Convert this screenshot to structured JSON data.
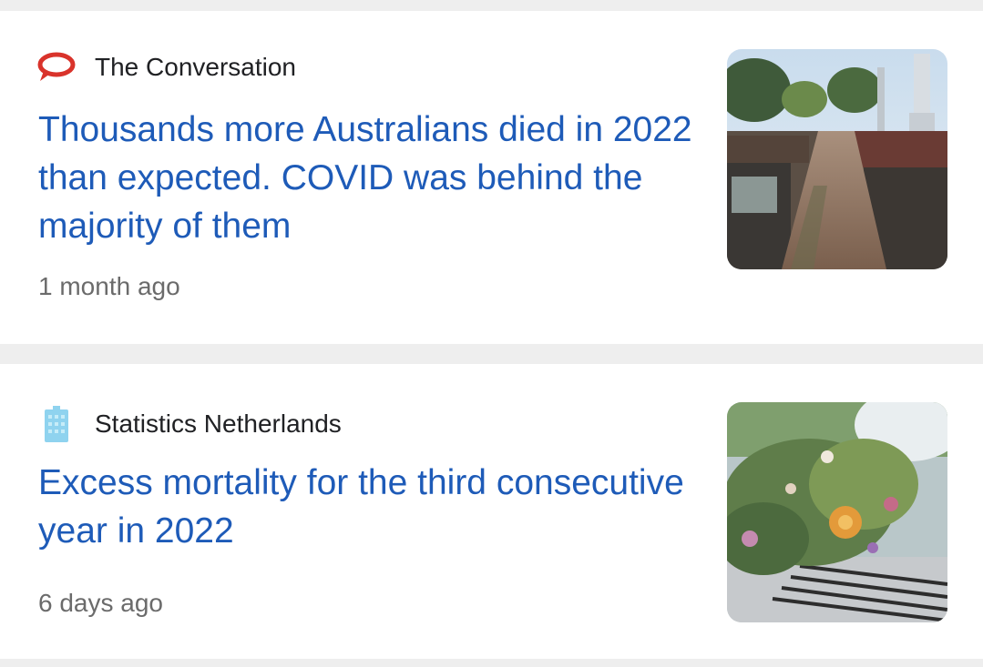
{
  "articles": [
    {
      "source": "The Conversation",
      "source_icon": "speech-bubble-icon",
      "source_icon_color": "#d9332b",
      "headline": "Thousands more Australians died in 2022 than expected. COVID was behind the majority of them",
      "time": "1 month ago",
      "thumbnail": "cemetery-thumbnail"
    },
    {
      "source": "Statistics Netherlands",
      "source_icon": "building-icon",
      "source_icon_color": "#8fd3ef",
      "headline": "Excess mortality for the third consecutive year in 2022",
      "time": "6 days ago",
      "thumbnail": "flowers-thumbnail"
    }
  ]
}
